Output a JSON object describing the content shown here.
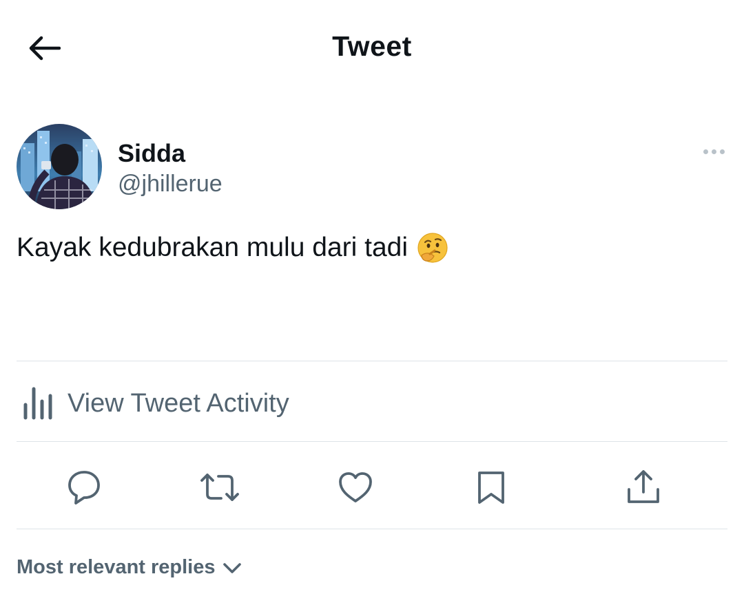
{
  "header": {
    "title": "Tweet",
    "back_icon": "arrow-left-icon"
  },
  "tweet": {
    "author": {
      "display_name": "Sidda",
      "handle": "@jhillerue"
    },
    "text": "Kayak kedubrakan mulu dari tadi",
    "emoji": "🤔",
    "more_icon": "more-horizontal-icon"
  },
  "activity": {
    "label": "View Tweet Activity",
    "icon": "bar-chart-icon"
  },
  "actions": [
    {
      "name": "reply",
      "icon": "speech-bubble-icon"
    },
    {
      "name": "retweet",
      "icon": "retweet-icon"
    },
    {
      "name": "like",
      "icon": "heart-icon"
    },
    {
      "name": "bookmark",
      "icon": "bookmark-icon"
    },
    {
      "name": "share",
      "icon": "share-icon"
    }
  ],
  "replies": {
    "sort_label": "Most relevant replies",
    "chevron_icon": "chevron-down-icon"
  },
  "colors": {
    "primary_text": "#0f1419",
    "secondary_text": "#536471",
    "divider": "#dde3e8",
    "background": "#ffffff"
  }
}
